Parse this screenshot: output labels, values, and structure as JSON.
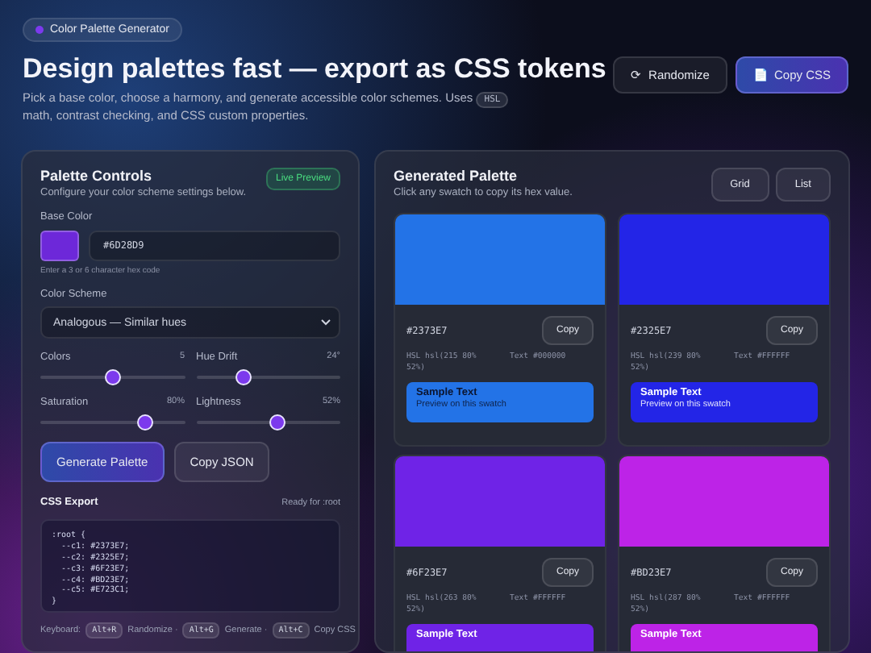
{
  "badge": {
    "label": "Color Palette Generator",
    "color": "#7c3aed"
  },
  "header": {
    "title": "Design palettes fast — export as CSS tokens",
    "subtitle_before": "Pick a base color, choose a harmony, and generate accessible color schemes. Uses",
    "subtitle_code": "HSL",
    "subtitle_after": "math, contrast checking, and CSS custom properties.",
    "buttons": [
      {
        "icon": "⟳",
        "label": "Randomize",
        "kind": "secondary"
      },
      {
        "icon": "📄",
        "label": "Copy CSS",
        "kind": "primary"
      }
    ]
  },
  "controls": {
    "title": "Palette Controls",
    "subtitle": "Configure your color scheme settings below.",
    "tag": "Live Preview",
    "base_label": "Base Color",
    "base_value": "#6D28D9",
    "base_hint": "Enter a 3 or 6 character hex code",
    "scheme_label": "Color Scheme",
    "scheme_value": "Analogous — Similar hues",
    "sliders": [
      {
        "label": "Colors",
        "reading": "5",
        "level": 0.5
      },
      {
        "label": "Hue Drift",
        "reading": "24°",
        "level": 0.33
      },
      {
        "label": "Saturation",
        "reading": "80%",
        "level": 0.73
      },
      {
        "label": "Lightness",
        "reading": "52%",
        "level": 0.56
      }
    ],
    "actions": [
      {
        "label": "Generate Palette",
        "kind": "primary"
      },
      {
        "label": "Copy JSON",
        "kind": "secondary"
      }
    ],
    "export_title": "CSS Export",
    "export_status": "Ready for :root",
    "code": ":root {\n  --c1: #2373E7;\n  --c2: #2325E7;\n  --c3: #6F23E7;\n  --c4: #BD23E7;\n  --c5: #E723C1;\n}",
    "shortcuts": [
      {
        "prefix": "Keyboard:",
        "key": "Alt+R",
        "action": "Randomize ·"
      },
      {
        "key": "Alt+G",
        "action": "Generate ·"
      },
      {
        "key": "Alt+C",
        "action": "Copy CSS"
      }
    ]
  },
  "palette": {
    "title": "Generated Palette",
    "subtitle": "Click any swatch to copy its hex value.",
    "views": [
      {
        "label": "Grid"
      },
      {
        "label": "List"
      }
    ],
    "swatches": [
      {
        "color": "#2373E7",
        "hex": "#2373E7",
        "hsl": "HSL hsl(215 80% 52%)",
        "text": "Text #000000",
        "kind": "dark",
        "sample": "Sample Text",
        "preview": "Preview on this swatch",
        "copy": "Copy"
      },
      {
        "color": "#2325E7",
        "hex": "#2325E7",
        "hsl": "HSL hsl(239 80% 52%)",
        "text": "Text #FFFFFF",
        "kind": "light",
        "sample": "Sample Text",
        "preview": "Preview on this swatch",
        "copy": "Copy"
      },
      {
        "color": "#6F23E7",
        "hex": "#6F23E7",
        "hsl": "HSL hsl(263 80% 52%)",
        "text": "Text #FFFFFF",
        "kind": "light",
        "sample": "Sample Text",
        "copy": "Copy"
      },
      {
        "color": "#BD23E7",
        "hex": "#BD23E7",
        "hsl": "HSL hsl(287 80% 52%)",
        "text": "Text #FFFFFF",
        "kind": "light",
        "sample": "Sample Text",
        "copy": "Copy"
      }
    ]
  }
}
